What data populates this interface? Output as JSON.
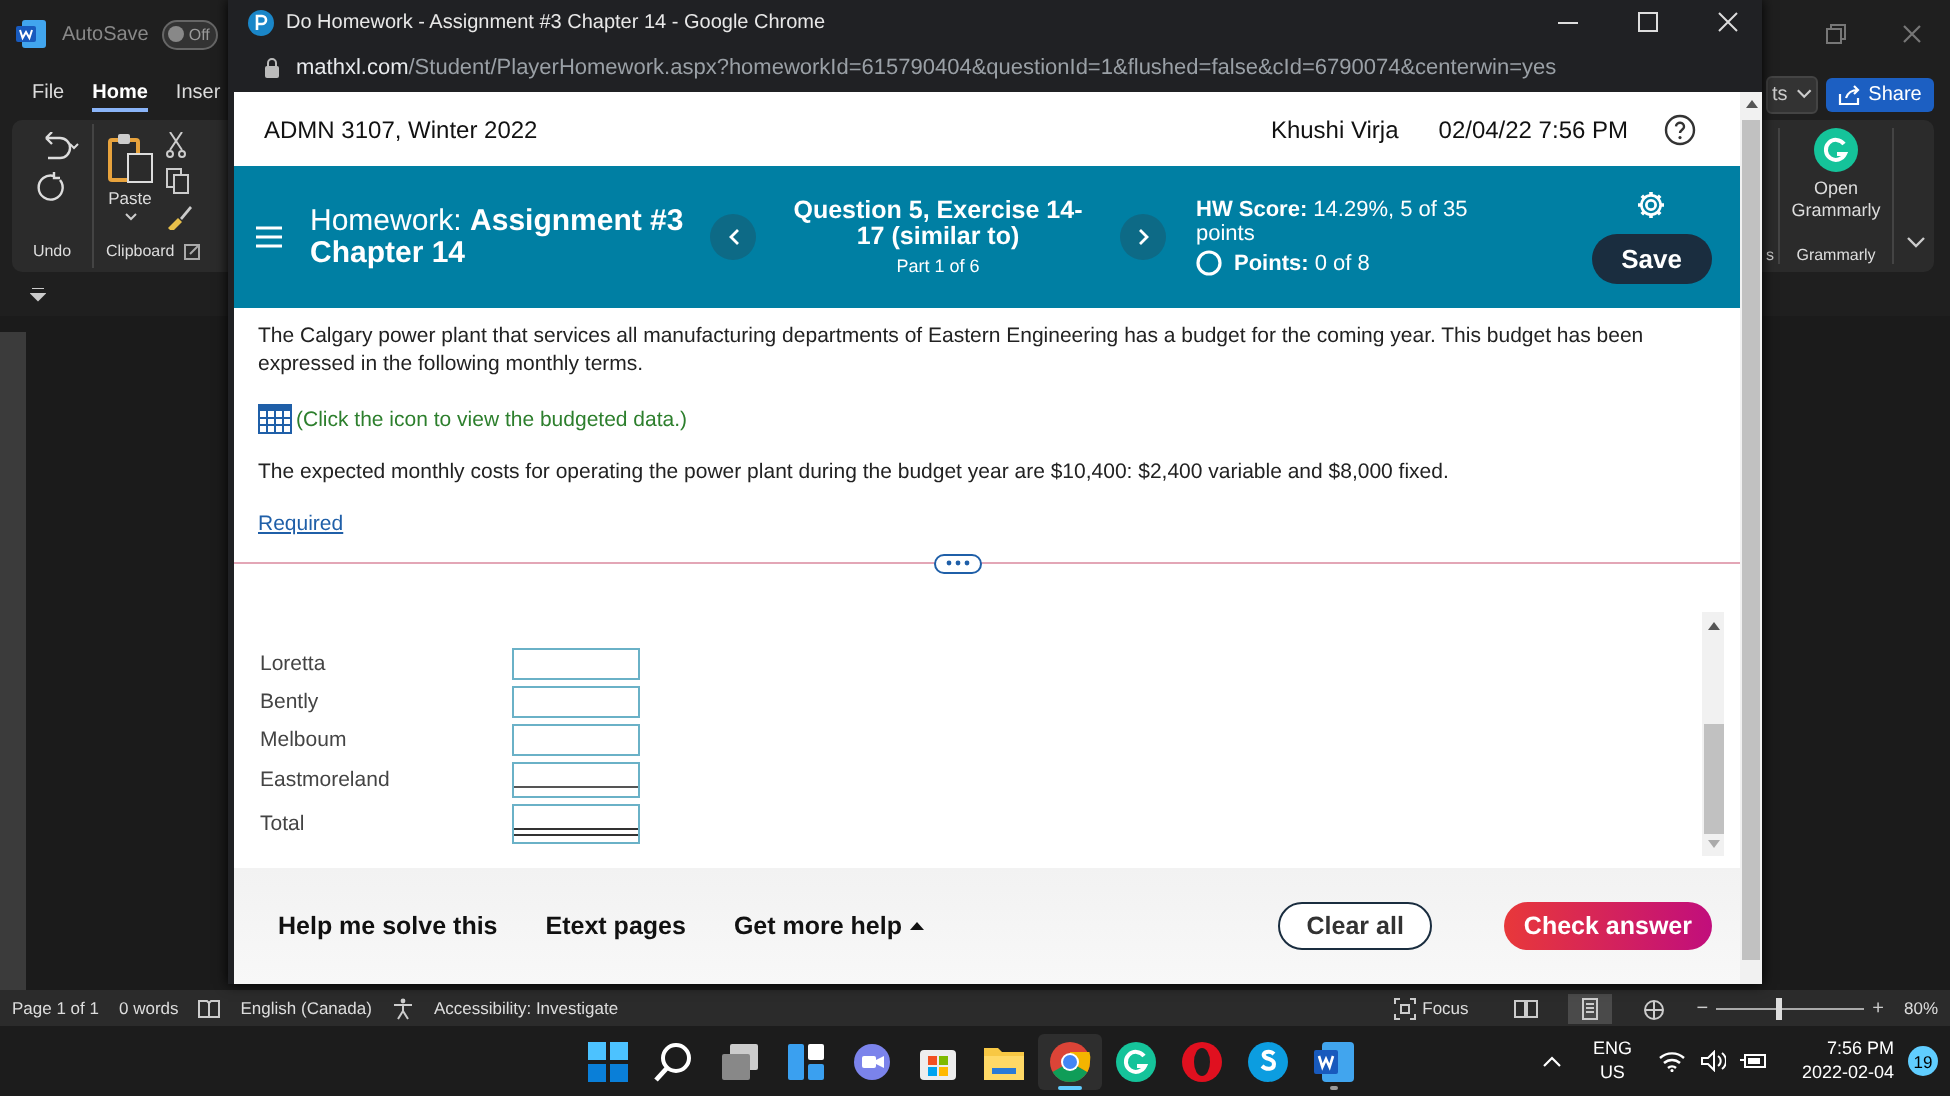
{
  "word": {
    "autosave_label": "AutoSave",
    "autosave": {
      "on": false,
      "label": "Off"
    },
    "tabs": [
      {
        "label": "File",
        "selected": false
      },
      {
        "label": "Home",
        "selected": true
      },
      {
        "label": "Inser",
        "selected": false
      }
    ],
    "ribbon_cut_text": "ts",
    "share": "Share",
    "paste": "Paste",
    "groups": [
      "Undo",
      "Clipboard"
    ],
    "grammarly_button": "Open Grammarly",
    "grammarly_group": "Grammarly",
    "cut_group": "s",
    "status_bar": {
      "page": "Page 1 of 1",
      "words": "0 words",
      "language": "English (Canada)",
      "accessibility": "Accessibility: Investigate",
      "focus": "Focus",
      "views": [
        {
          "selected": false
        },
        {
          "selected": true
        },
        {
          "selected": false
        }
      ],
      "zoom_out": "−",
      "zoom_in": "+",
      "zoom": {
        "level": 0.4
      },
      "zoom_reading": "80%"
    }
  },
  "taskbar": {
    "apps": [
      {
        "selected": false,
        "running": false
      },
      {
        "selected": false,
        "running": false
      },
      {
        "selected": false,
        "running": false
      },
      {
        "selected": false,
        "running": false
      },
      {
        "selected": false,
        "running": false
      },
      {
        "selected": false,
        "running": false
      },
      {
        "selected": false,
        "running": false
      },
      {
        "selected": true,
        "running": true
      },
      {
        "selected": false,
        "running": false
      },
      {
        "selected": false,
        "running": false
      },
      {
        "selected": false,
        "running": false
      },
      {
        "selected": false,
        "running": true
      }
    ],
    "language": "ENG",
    "region": "US",
    "time": "7:56 PM",
    "date": "2022-02-04",
    "badge": "19"
  },
  "browser": {
    "title": "Do Homework - Assignment #3 Chapter 14 - Google Chrome",
    "url_host": "mathxl.com",
    "url_path": "/Student/PlayerHomework.aspx?homeworkId=615790404&questionId=1&flushed=false&cId=6790074&centerwin=yes",
    "page": {
      "course": "ADMN 3107, Winter 2022",
      "user": "Khushi Virja",
      "datetime": "02/04/22 7:56 PM",
      "homework": "Homework:  **Assignment #3 Chapter 14**",
      "question": "Question 5, Exercise 14-17 (similar to)",
      "part": "Part 1 of 6",
      "score": "**HW Score:** 14.29%, 5 of 35 points",
      "points": "**Points:** 0 of 8",
      "save": "Save",
      "intro": "The Calgary power plant that services all manufacturing departments of Eastern Engineering has a budget for the coming year. This budget has been expressed in the following monthly terms.",
      "data_link": "(Click the icon to view the budgeted data.)",
      "costs": "The expected monthly costs for operating the power plant during the budget year are $10,400: $2,400 variable and $8,000 fixed.",
      "required": "Required",
      "rows": [
        {
          "label": "Loretta",
          "kind": "plain"
        },
        {
          "label": "Bently",
          "kind": "plain"
        },
        {
          "label": "Melboum",
          "kind": "plain"
        },
        {
          "label": "Eastmoreland",
          "kind": "single"
        },
        {
          "label": "Total",
          "kind": "double"
        }
      ],
      "footer_links": [
        "Help me solve this",
        "Etext pages",
        "Get more help"
      ],
      "clear": "Clear all",
      "check": "Check answer"
    }
  }
}
